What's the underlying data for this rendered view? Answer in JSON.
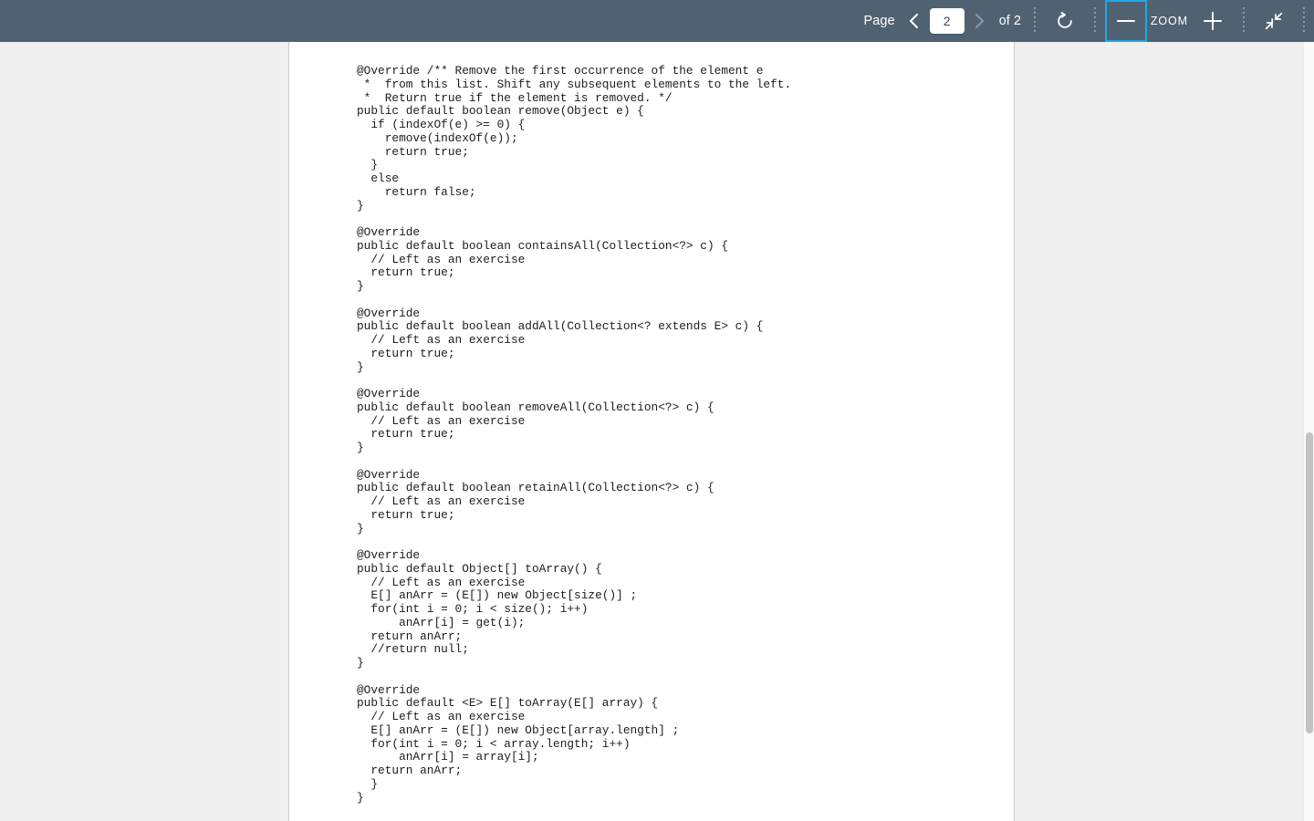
{
  "toolbar": {
    "page_label": "Page",
    "prev_page_icon": "chevron-left-icon",
    "page_value": "2",
    "next_page_icon": "chevron-right-icon",
    "page_total": "of 2",
    "rotate_icon": "rotate-clockwise-icon",
    "zoom_out_icon": "minus-icon",
    "zoom_label": "ZOOM",
    "zoom_in_icon": "plus-icon",
    "exit_fullscreen_icon": "collapse-arrows-icon",
    "focus_ring_color": "#1fa6e0",
    "background_color": "#506272",
    "text_color": "#ffffff"
  },
  "viewer": {
    "background_color": "#f0f0f0",
    "page_color": "#ffffff",
    "scrollbar_thumb_color": "#c2c2c2"
  },
  "document": {
    "code": "@Override /** Remove the first occurrence of the element e\n *  from this list. Shift any subsequent elements to the left.\n *  Return true if the element is removed. */\npublic default boolean remove(Object e) {\n  if (indexOf(e) >= 0) {\n    remove(indexOf(e));\n    return true;\n  }\n  else\n    return false;\n}\n\n@Override\npublic default boolean containsAll(Collection<?> c) {\n  // Left as an exercise\n  return true;\n}\n\n@Override\npublic default boolean addAll(Collection<? extends E> c) {\n  // Left as an exercise\n  return true;\n}\n\n@Override\npublic default boolean removeAll(Collection<?> c) {\n  // Left as an exercise\n  return true;\n}\n\n@Override\npublic default boolean retainAll(Collection<?> c) {\n  // Left as an exercise\n  return true;\n}\n\n@Override\npublic default Object[] toArray() {\n  // Left as an exercise\n  E[] anArr = (E[]) new Object[size()] ;\n  for(int i = 0; i < size(); i++)\n      anArr[i] = get(i);\n  return anArr;\n  //return null;\n}\n\n@Override\npublic default <E> E[] toArray(E[] array) {\n  // Left as an exercise\n  E[] anArr = (E[]) new Object[array.length] ;\n  for(int i = 0; i < array.length; i++)\n      anArr[i] = array[i];\n  return anArr;\n  }\n}"
  }
}
